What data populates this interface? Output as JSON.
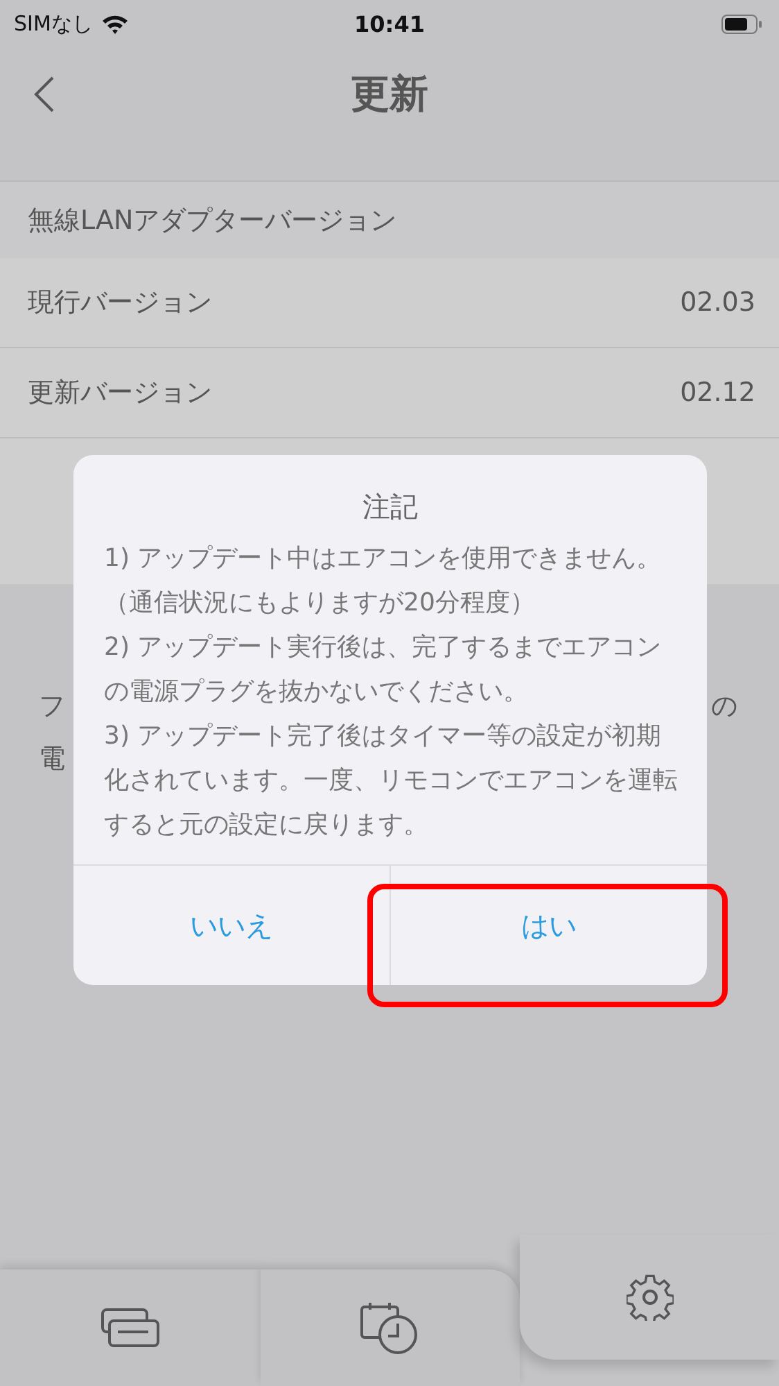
{
  "status_bar": {
    "carrier": "SIMなし",
    "time": "10:41"
  },
  "nav": {
    "title": "更新"
  },
  "section": {
    "header": "無線LANアダプターバージョン",
    "rows": [
      {
        "label": "現行バージョン",
        "value": "02.03"
      },
      {
        "label": "更新バージョン",
        "value": "02.12"
      }
    ]
  },
  "hidden_text": [
    {
      "left": "フ",
      "right": "の"
    },
    {
      "left": "電"
    }
  ],
  "dialog": {
    "title": "注記",
    "items": [
      "1) アップデート中はエアコンを使用できません。（通信状況にもよりますが20分程度）",
      "2) アップデート実行後は、完了するまでエアコンの電源プラグを抜かないでください。",
      "3) アップデート完了後はタイマー等の設定が初期化されています。一度、リモコンでエアコンを運転すると元の設定に戻ります。"
    ],
    "buttons": [
      {
        "label": "いいえ",
        "highlighted": false
      },
      {
        "label": "はい",
        "highlighted": true
      }
    ]
  },
  "tabs": [
    {
      "kind": "units",
      "selected": false
    },
    {
      "kind": "schedule",
      "selected": false
    },
    {
      "kind": "settings",
      "selected": true
    }
  ]
}
